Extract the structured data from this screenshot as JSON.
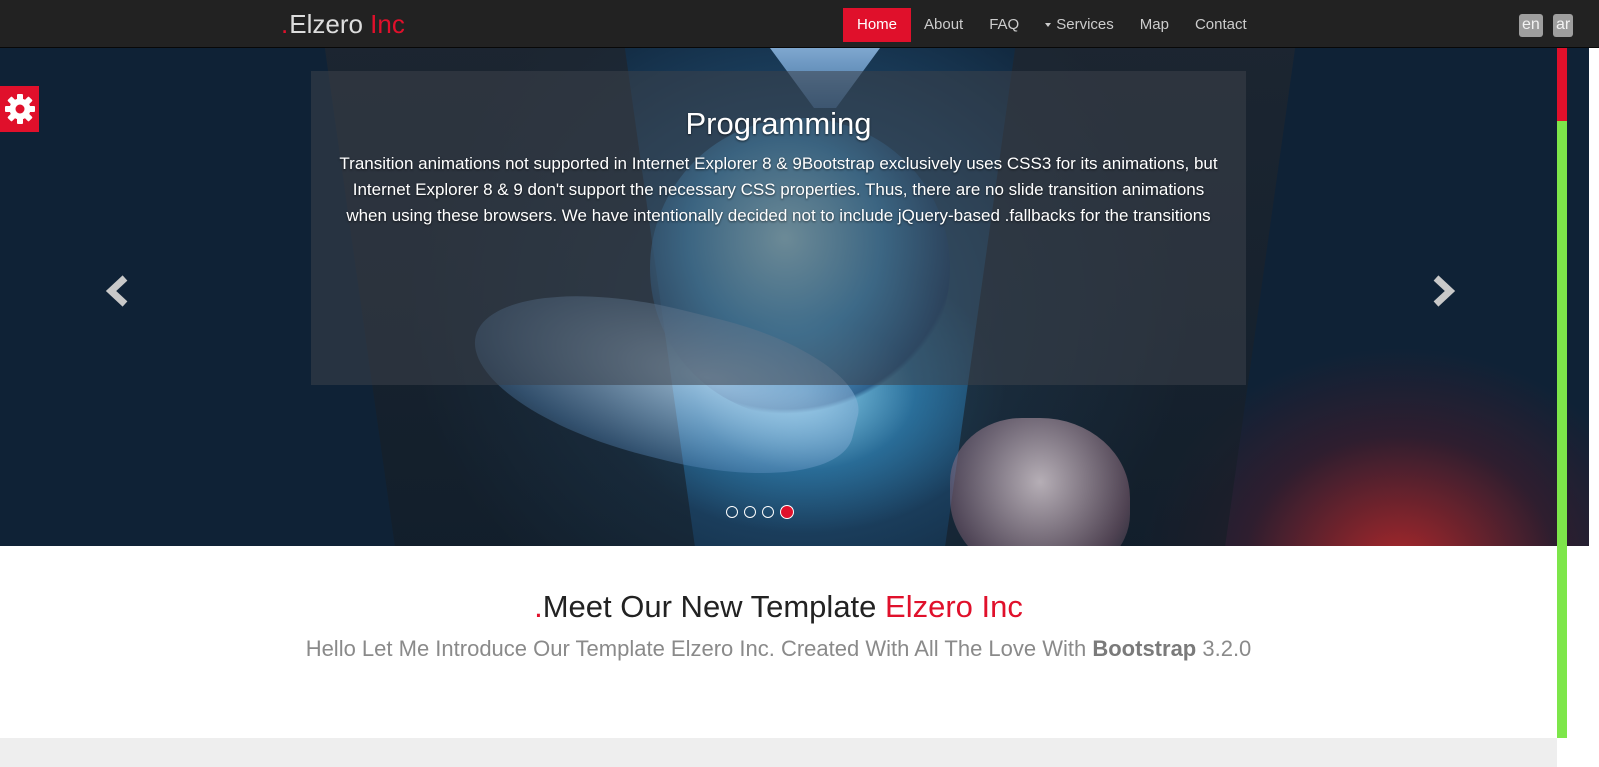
{
  "brand": {
    "dot": ".",
    "name": "Elzero",
    "suffix": "Inc"
  },
  "nav": {
    "items": [
      {
        "label": "Home"
      },
      {
        "label": "About"
      },
      {
        "label": "FAQ"
      },
      {
        "label": "Services"
      },
      {
        "label": "Map"
      },
      {
        "label": "Contact"
      }
    ],
    "active": "Home"
  },
  "languages": {
    "en": "en",
    "ar": "ar"
  },
  "hero": {
    "caption_title": "Programming",
    "caption_text": "Transition animations not supported in Internet Explorer 8 & 9Bootstrap exclusively uses CSS3 for its animations, but Internet Explorer 8 & 9 don't support the necessary CSS properties. Thus, there are no slide transition animations when using these browsers. We have intentionally decided not to include jQuery-based .fallbacks for the transitions",
    "slide_count": 4,
    "active_slide": 4
  },
  "intro": {
    "heading_dot": ".",
    "heading_text": "Meet Our New Template ",
    "heading_accent": "Elzero Inc",
    "sub_text": "Hello Let Me Introduce Our Template Elzero Inc. Created With All The Love With ",
    "sub_bold": "Bootstrap",
    "sub_version": " 3.2.0"
  },
  "colors": {
    "accent": "#e0102b",
    "navbar": "#222222",
    "scrollbar": "#7de64a"
  },
  "icons": {
    "settings": "gear-icon",
    "prev": "chevron-left-icon",
    "next": "chevron-right-icon",
    "dropdown": "caret-down-icon"
  }
}
